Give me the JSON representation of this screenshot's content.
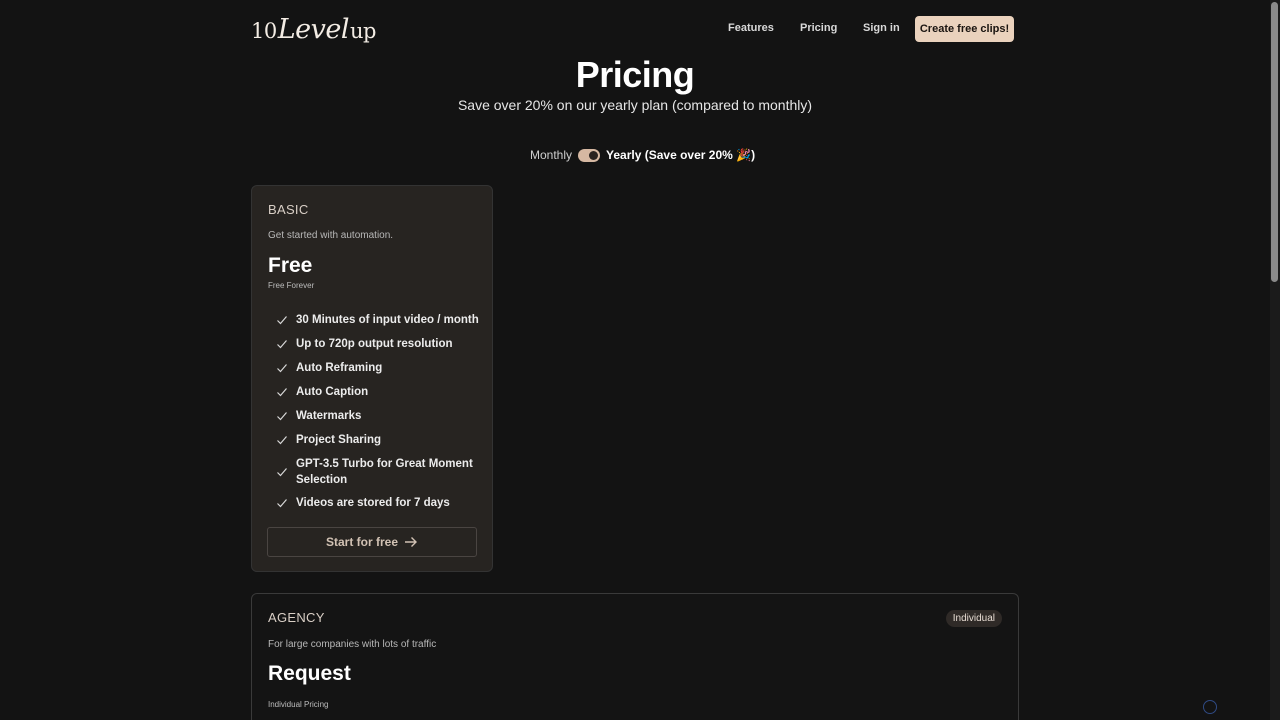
{
  "brand": {
    "logo_prefix": "10",
    "logo_main": "Level",
    "logo_suffix": "up"
  },
  "nav": {
    "links": [
      "Features",
      "Pricing",
      "Sign in"
    ],
    "cta_label": "Create free clips!"
  },
  "header": {
    "title": "Pricing",
    "subtitle": "Save over 20% on our yearly plan (compared to monthly)"
  },
  "billing": {
    "monthly_label": "Monthly",
    "yearly_label": "Yearly (Save over 20% 🎉)",
    "selected": "Yearly"
  },
  "plans": {
    "basic": {
      "name": "BASIC",
      "description": "Get started with automation.",
      "price": "Free",
      "price_note": "Free Forever",
      "features": [
        "30 Minutes of input video / month",
        "Up to 720p output resolution",
        "Auto Reframing",
        "Auto Caption",
        "Watermarks",
        "Project Sharing",
        "GPT-3.5 Turbo for Great Moment Selection",
        "Videos are stored for 7 days"
      ],
      "button_label": "Start for free"
    },
    "agency": {
      "name": "AGENCY",
      "description": "For large companies with lots of traffic",
      "price": "Request",
      "price_note": "Individual Pricing",
      "badge": "Individual"
    }
  },
  "colors": {
    "background": "#131313",
    "card_background": "#272421",
    "accent": "#ead2bd",
    "text": "#ffffff"
  },
  "icons": [
    "check-icon",
    "arrow-right-icon"
  ]
}
